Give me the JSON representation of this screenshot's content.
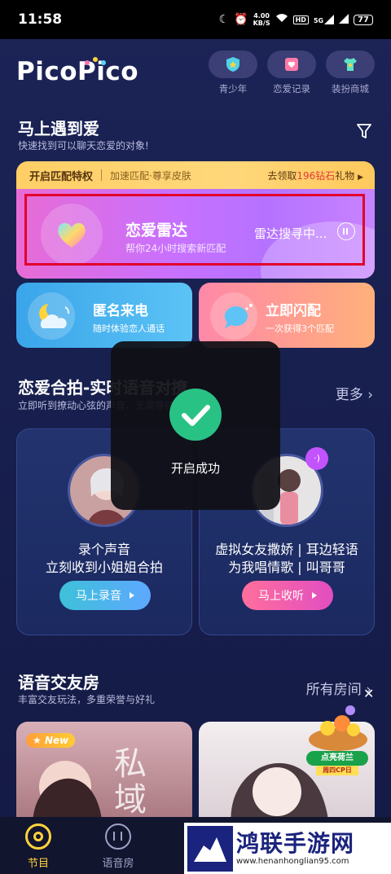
{
  "status_bar": {
    "time": "11:58",
    "net_speed_value": "4.00",
    "net_speed_unit": "KB/S",
    "hd_label": "HD",
    "signal_label": "5G",
    "battery": "77"
  },
  "header": {
    "logo": "PicoPico",
    "buttons": [
      {
        "label": "青少年",
        "icon": "shield-icon"
      },
      {
        "label": "恋爱记录",
        "icon": "love-record-icon"
      },
      {
        "label": "装扮商城",
        "icon": "shirt-icon"
      }
    ]
  },
  "match_section": {
    "title": "马上遇到爱",
    "subtitle": "快速找到可以聊天恋爱的对象!",
    "privilege": {
      "title": "开启匹配特权",
      "desc": "加速匹配·尊享皮肤",
      "reward_prefix": "去领取",
      "reward_highlight": "196钻石",
      "reward_suffix": "礼物"
    },
    "radar": {
      "title": "恋爱雷达",
      "subtitle": "帮你24小时搜索新匹配",
      "status": "雷达搜寻中..."
    },
    "cards": [
      {
        "title": "匿名来电",
        "subtitle": "随时体验恋人通话"
      },
      {
        "title": "立即闪配",
        "subtitle": "一次获得3个匹配"
      }
    ]
  },
  "duet_section": {
    "title": "恋爱合拍-实时语音对撩",
    "subtitle": "立即听到撩动心弦的声音，无需等待",
    "more": "更多",
    "cards": [
      {
        "line1": "录个声音",
        "line2": "立刻收到小姐姐合拍",
        "button": "马上录音"
      },
      {
        "line1": "虚拟女友撒娇 | 耳边轻语",
        "line2": "为我唱情歌 | 叫哥哥",
        "button": "马上收听"
      }
    ]
  },
  "toast": {
    "text": "开启成功"
  },
  "room_section": {
    "title": "语音交友房",
    "subtitle": "丰富交友玩法，多重荣誉与好礼",
    "more": "所有房间",
    "new_badge": "New",
    "room_text": "私域",
    "promo_label": "点亮荷兰",
    "promo_sub": "周四CP日"
  },
  "bottom_nav": {
    "items": [
      {
        "label": "节目",
        "active": true
      },
      {
        "label": "语音房",
        "active": false
      }
    ]
  },
  "watermark": {
    "title": "鸿联手游网",
    "url": "www.henanhonglian95.com"
  },
  "colors": {
    "accent_yellow": "#ffd43b",
    "radar_purple": "#c771ff",
    "highlight_red": "#e3002b",
    "success_green": "#29c285"
  }
}
